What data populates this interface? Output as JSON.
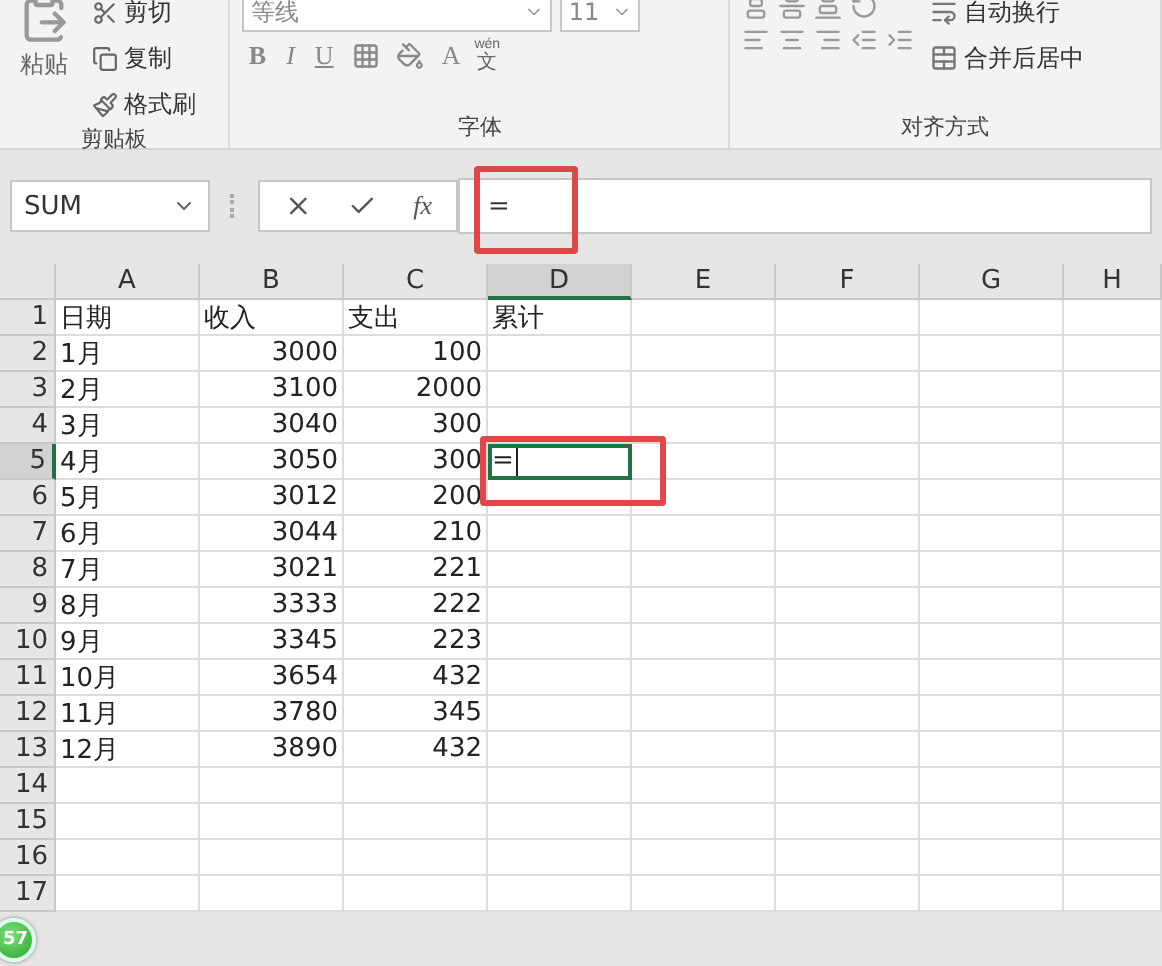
{
  "ribbon": {
    "groups": [
      {
        "kind": "clipboard",
        "label": "剪贴板",
        "paste": "粘贴",
        "items": [
          "剪切",
          "复制",
          "格式刷"
        ]
      },
      {
        "kind": "font",
        "label": "字体",
        "font_name": "等线",
        "font_size": "11",
        "styles": [
          "B",
          "I",
          "U"
        ],
        "font_color": "A",
        "phonetic_top": "wén",
        "phonetic_bottom": "文"
      },
      {
        "kind": "alignment",
        "label": "对齐方式",
        "items": [
          "自动换行",
          "合并后居中"
        ]
      }
    ]
  },
  "formula_bar": {
    "name_box": "SUM",
    "fx": "fx",
    "value": "="
  },
  "columns": [
    {
      "label": "A",
      "selected": false
    },
    {
      "label": "B",
      "numeric": true,
      "selected": false
    },
    {
      "label": "C",
      "numeric": true,
      "selected": false
    },
    {
      "label": "D",
      "selected": true
    },
    {
      "label": "E",
      "selected": false
    },
    {
      "label": "F",
      "selected": false
    },
    {
      "label": "G",
      "selected": false
    },
    {
      "label": "H",
      "selected": false
    }
  ],
  "rows": [
    {
      "number": "1",
      "kind": "header",
      "selected": false,
      "cells": [
        "日期",
        "收入",
        "支出",
        "累计"
      ]
    },
    {
      "number": "2",
      "kind": "data",
      "selected": false,
      "cells": [
        "1月",
        "3000",
        "100"
      ]
    },
    {
      "number": "3",
      "kind": "data",
      "selected": false,
      "cells": [
        "2月",
        "3100",
        "2000"
      ]
    },
    {
      "number": "4",
      "kind": "data",
      "selected": false,
      "cells": [
        "3月",
        "3040",
        "300"
      ]
    },
    {
      "number": "5",
      "kind": "data",
      "selected": true,
      "cells": [
        "4月",
        "3050",
        "300",
        "="
      ]
    },
    {
      "number": "6",
      "kind": "data",
      "selected": false,
      "cells": [
        "5月",
        "3012",
        "200"
      ]
    },
    {
      "number": "7",
      "kind": "data",
      "selected": false,
      "cells": [
        "6月",
        "3044",
        "210"
      ]
    },
    {
      "number": "8",
      "kind": "data",
      "selected": false,
      "cells": [
        "7月",
        "3021",
        "221"
      ]
    },
    {
      "number": "9",
      "kind": "data",
      "selected": false,
      "cells": [
        "8月",
        "3333",
        "222"
      ]
    },
    {
      "number": "10",
      "kind": "data",
      "selected": false,
      "cells": [
        "9月",
        "3345",
        "223"
      ]
    },
    {
      "number": "11",
      "kind": "data",
      "selected": false,
      "cells": [
        "10月",
        "3654",
        "432"
      ]
    },
    {
      "number": "12",
      "kind": "data",
      "selected": false,
      "cells": [
        "11月",
        "3780",
        "345"
      ]
    },
    {
      "number": "13",
      "kind": "data",
      "selected": false,
      "cells": [
        "12月",
        "3890",
        "432"
      ]
    },
    {
      "number": "14",
      "kind": "data",
      "selected": false,
      "cells": []
    },
    {
      "number": "15",
      "kind": "data",
      "selected": false,
      "cells": []
    },
    {
      "number": "16",
      "kind": "data",
      "selected": false,
      "cells": []
    },
    {
      "number": "17",
      "kind": "data",
      "selected": false,
      "cells": []
    }
  ],
  "floating_badge": "57"
}
